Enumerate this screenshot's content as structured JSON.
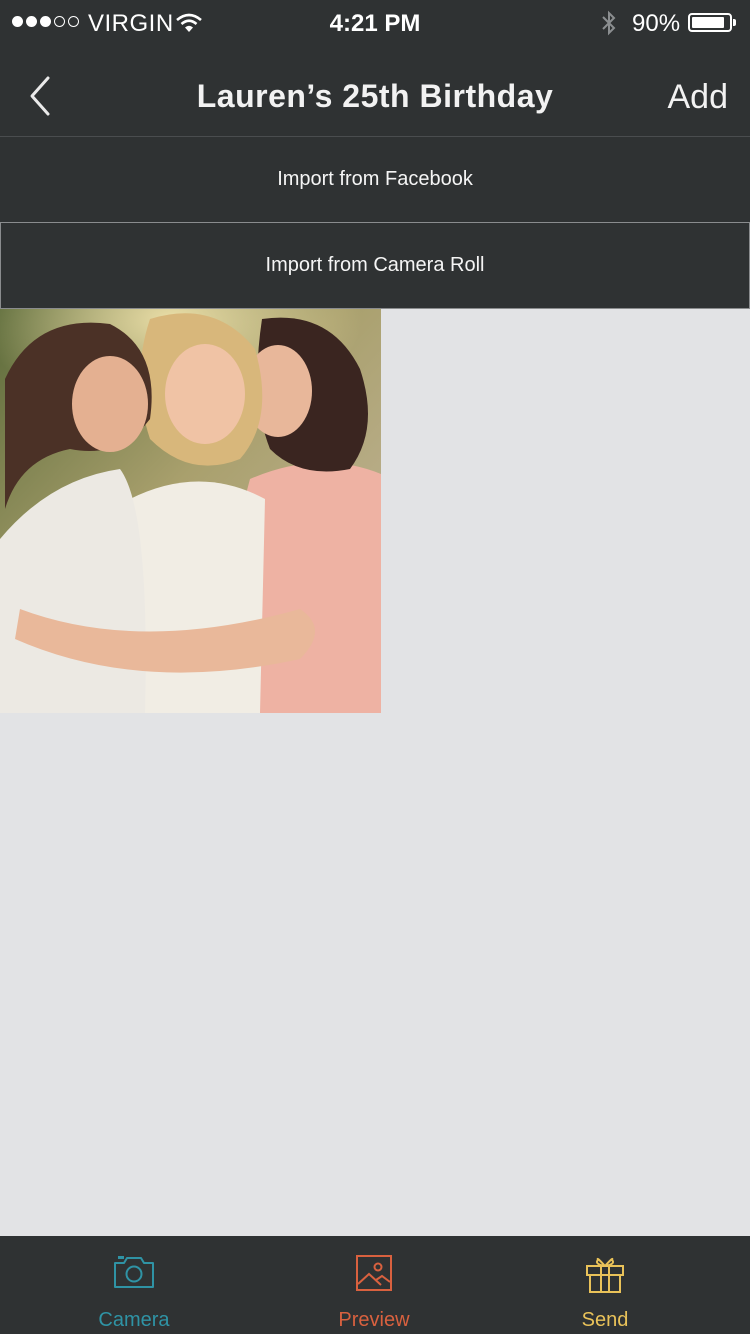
{
  "status_bar": {
    "carrier": "VIRGIN",
    "time": "4:21 PM",
    "battery": "90%",
    "battery_level": 0.9,
    "signal_bars": 3,
    "signal_total": 5
  },
  "nav": {
    "title": "Lauren’s 25th Birthday",
    "add_label": "Add",
    "back_icon": "chevron-left-icon"
  },
  "actions": {
    "import_facebook": "Import from Facebook",
    "import_camera_roll": "Import from Camera Roll"
  },
  "tabs": [
    {
      "label": "Camera",
      "icon": "camera-icon",
      "color": "#2f93a5"
    },
    {
      "label": "Preview",
      "icon": "image-icon",
      "color": "#d9613f"
    },
    {
      "label": "Send",
      "icon": "gift-icon",
      "color": "#e9c259"
    }
  ],
  "colors": {
    "bar_background": "#2f3233",
    "content_background": "#e2e3e5"
  }
}
